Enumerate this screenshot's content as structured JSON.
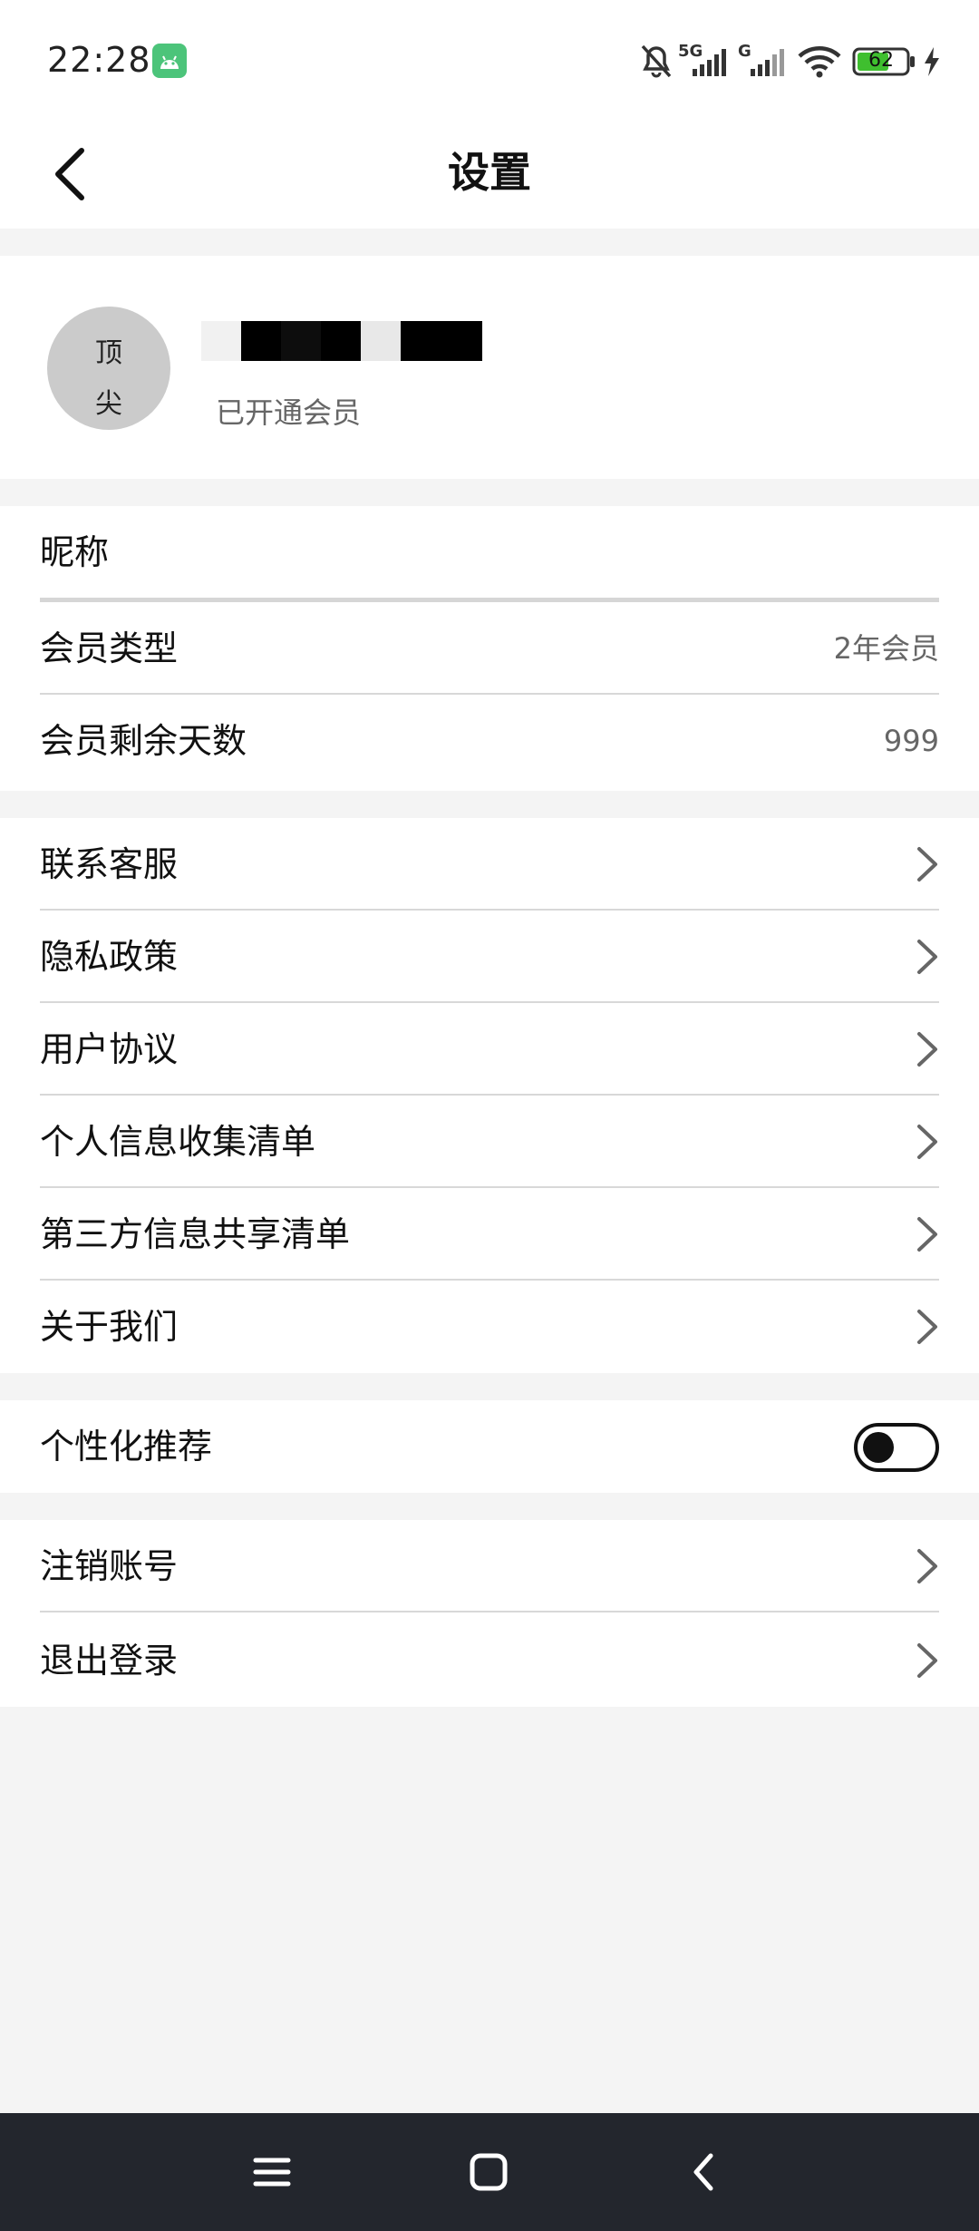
{
  "status_bar": {
    "time": "22:28",
    "app_icon": "android-icon",
    "network_1": "5G",
    "network_2": "G",
    "battery": "62",
    "icons": [
      "mute-bell-icon",
      "signal-icon",
      "signal-icon",
      "wifi-icon",
      "battery-icon",
      "charging-icon"
    ],
    "battery_color": "#3fbf2f"
  },
  "header": {
    "title": "设置",
    "back_icon": "chevron-left-icon"
  },
  "profile": {
    "avatar_chars": [
      "顶",
      "尖"
    ],
    "member_status": "已开通会员"
  },
  "account_section": [
    {
      "label": "昵称",
      "value": ""
    },
    {
      "label": "会员类型",
      "value": "2年会员"
    },
    {
      "label": "会员剩余天数",
      "value": "999"
    }
  ],
  "links_section": [
    {
      "label": "联系客服"
    },
    {
      "label": "隐私政策"
    },
    {
      "label": "用户协议"
    },
    {
      "label": "个人信息收集清单"
    },
    {
      "label": "第三方信息共享清单"
    },
    {
      "label": "关于我们"
    }
  ],
  "personalization": {
    "label": "个性化推荐",
    "enabled": false
  },
  "account_actions": [
    {
      "label": "注销账号"
    },
    {
      "label": "退出登录"
    }
  ],
  "nav_bar": {
    "buttons": [
      "menu-icon",
      "home-square-icon",
      "back-triangle-icon"
    ]
  }
}
